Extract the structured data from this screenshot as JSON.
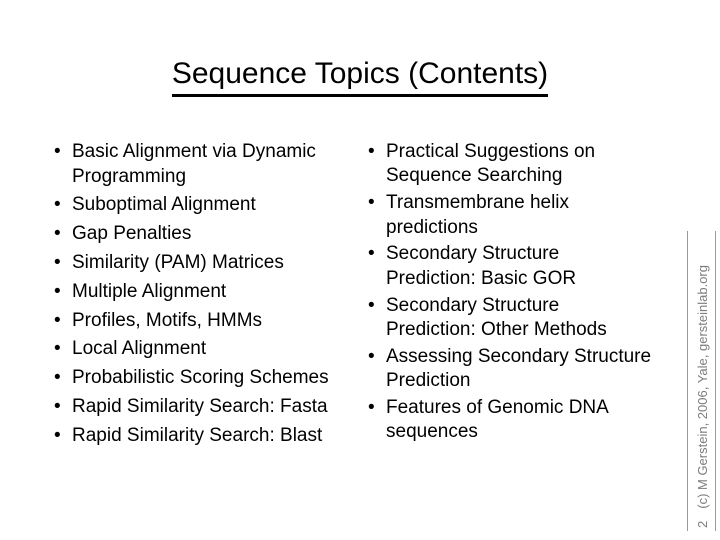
{
  "slide": {
    "title": "Sequence Topics (Contents)",
    "background_color": "#ffffff",
    "text_color": "#000000"
  },
  "content": {
    "bullet_glyph": "•",
    "left_column": [
      "Basic Alignment via Dynamic Programming",
      "Suboptimal Alignment",
      "Gap Penalties",
      "Similarity (PAM) Matrices",
      "Multiple Alignment",
      "Profiles, Motifs, HMMs",
      "Local Alignment",
      "Probabilistic Scoring Schemes",
      "Rapid Similarity Search: Fasta",
      "Rapid Similarity Search: Blast"
    ],
    "right_column": [
      "Practical Suggestions on Sequence Searching",
      "Transmembrane helix predictions",
      "Secondary Structure Prediction: Basic GOR",
      "Secondary Structure Prediction: Other Methods",
      "Assessing Secondary Structure Prediction",
      "Features of Genomic DNA sequences"
    ]
  },
  "credit": {
    "slide_number": "2",
    "text": "(c) M Gerstein, 2006, Yale, gersteinlab.org",
    "color": "#7d7d7d",
    "border_color": "#9a9a9a"
  }
}
